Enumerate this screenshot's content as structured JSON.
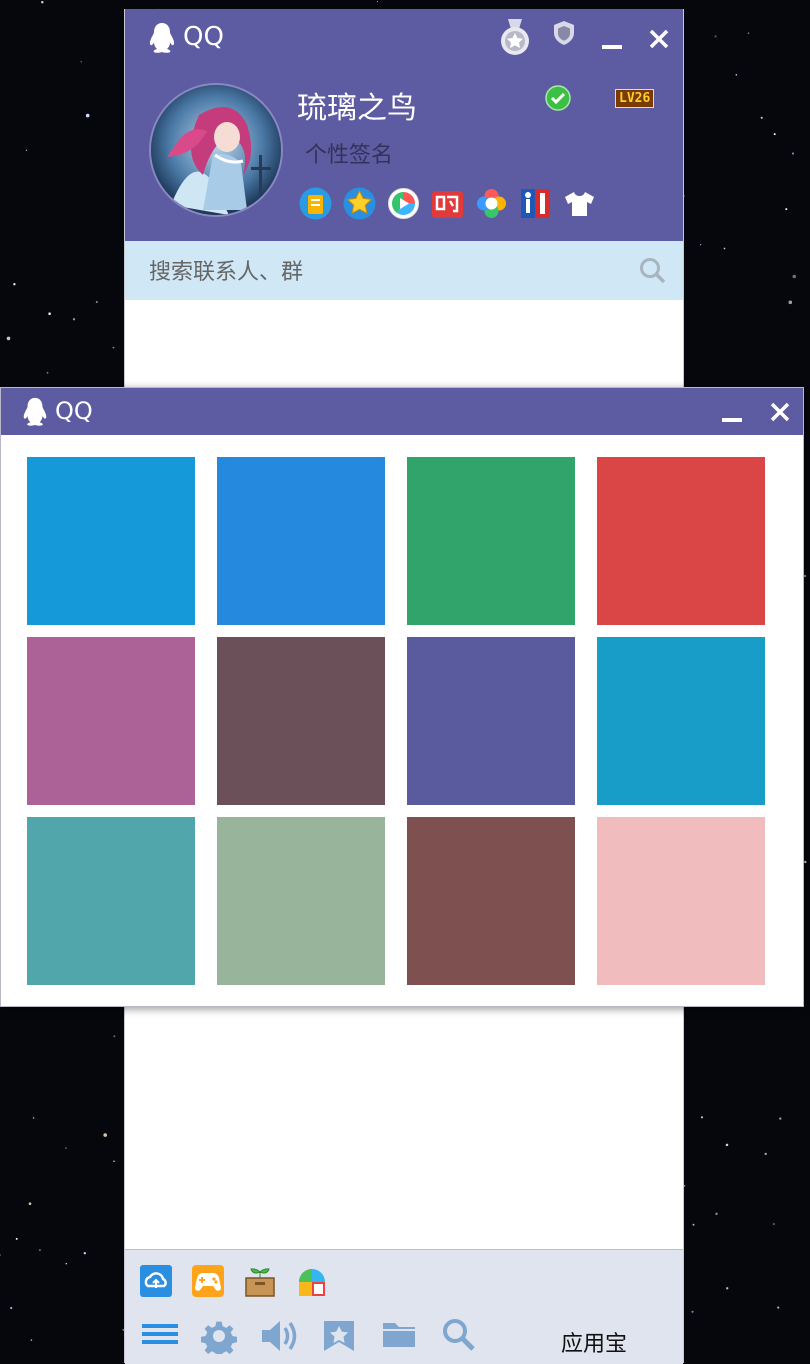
{
  "main_window": {
    "brand": "QQ",
    "nickname": "琉璃之鸟",
    "signature": "个性签名",
    "level_badge": "LV26",
    "search_placeholder": "搜索联系人、群",
    "header_color": "#5d5ba1",
    "search_bg": "#d0e8f5",
    "top_icons": [
      "medal-icon",
      "shield-icon"
    ],
    "window_controls": [
      "minimize-icon",
      "close-icon"
    ],
    "status_icon": "online-check-icon",
    "app_icons": [
      "qzone-icon",
      "vip-star-icon",
      "tencent-video-icon",
      "shopping-icon",
      "photo-wall-icon",
      "nba-vip-icon",
      "dress-up-icon"
    ],
    "bottom_apps": [
      "weiyun-icon",
      "games-icon",
      "farm-icon",
      "tencent-pc-manager-icon"
    ],
    "toolbar": [
      "menu-icon",
      "settings-icon",
      "sound-icon",
      "favorites-icon",
      "file-icon",
      "search-icon"
    ],
    "app_store_label": "应用宝"
  },
  "skin_picker": {
    "brand": "QQ",
    "swatches": [
      "#1599d8",
      "#2589de",
      "#30a46b",
      "#da4545",
      "#ad6297",
      "#6c5059",
      "#5a5a9f",
      "#189dc8",
      "#50a6ab",
      "#98b49a",
      "#7e5050",
      "#f0bcbe"
    ]
  }
}
